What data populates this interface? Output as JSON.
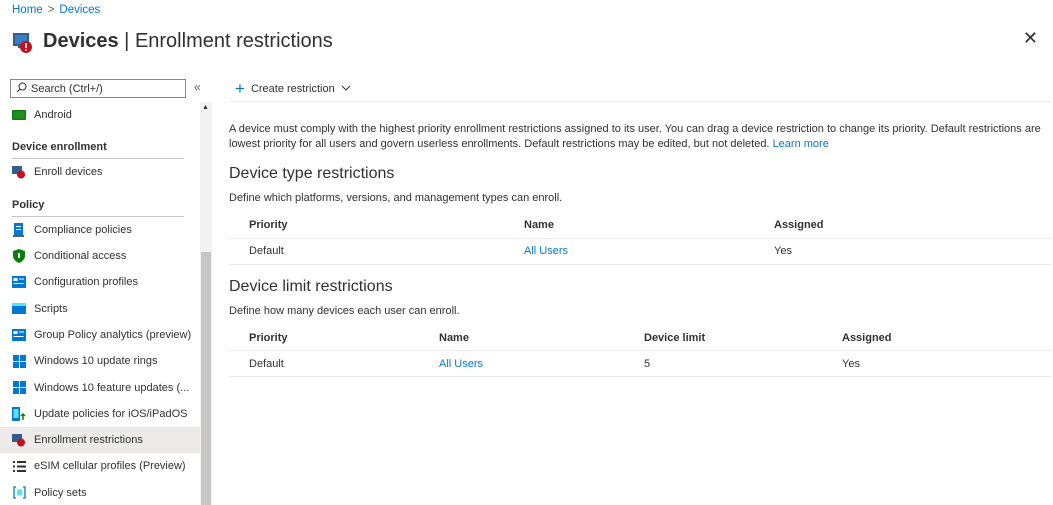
{
  "breadcrumb": {
    "home": "Home",
    "separator": ">",
    "current": "Devices"
  },
  "header": {
    "title_bold": "Devices",
    "title_sep": " | ",
    "title_rest": "Enrollment restrictions",
    "close": "✕"
  },
  "sidebar": {
    "search_placeholder": "Search (Ctrl+/)",
    "collapse": "«",
    "items": [
      {
        "label": "Android",
        "icon": "android-icon"
      },
      {
        "section": "Device enrollment"
      },
      {
        "label": "Enroll devices",
        "icon": "enroll-devices-icon"
      },
      {
        "section": "Policy"
      },
      {
        "label": "Compliance policies",
        "icon": "compliance-icon"
      },
      {
        "label": "Conditional access",
        "icon": "shield-icon"
      },
      {
        "label": "Configuration profiles",
        "icon": "config-profile-icon"
      },
      {
        "label": "Scripts",
        "icon": "scripts-icon"
      },
      {
        "label": "Group Policy analytics (preview)",
        "icon": "group-policy-icon"
      },
      {
        "label": "Windows 10 update rings",
        "icon": "windows-icon"
      },
      {
        "label": "Windows 10 feature updates (...",
        "icon": "windows-icon"
      },
      {
        "label": "Update policies for iOS/iPadOS",
        "icon": "ios-update-icon"
      },
      {
        "label": "Enrollment restrictions",
        "icon": "enrollment-restrictions-icon",
        "selected": true
      },
      {
        "label": "eSIM cellular profiles (Preview)",
        "icon": "esim-icon"
      },
      {
        "label": "Policy sets",
        "icon": "policy-sets-icon"
      }
    ]
  },
  "toolbar": {
    "create_label": "Create restriction"
  },
  "description": {
    "text": "A device must comply with the highest priority enrollment restrictions assigned to its user. You can drag a device restriction to change its priority. Default restrictions are lowest priority for all users and govern userless enrollments. Default restrictions may be edited, but not deleted.",
    "link": "Learn more"
  },
  "device_type": {
    "title": "Device type restrictions",
    "subtitle": "Define which platforms, versions, and management types can enroll.",
    "columns": [
      "Priority",
      "Name",
      "Assigned"
    ],
    "rows": [
      {
        "priority": "Default",
        "name": "All Users",
        "assigned": "Yes"
      }
    ]
  },
  "device_limit": {
    "title": "Device limit restrictions",
    "subtitle": "Define how many devices each user can enroll.",
    "columns": [
      "Priority",
      "Name",
      "Device limit",
      "Assigned"
    ],
    "rows": [
      {
        "priority": "Default",
        "name": "All Users",
        "limit": "5",
        "assigned": "Yes"
      }
    ]
  },
  "colors": {
    "accent": "#0078d4",
    "selected_bg": "#edebe9",
    "text": "#323130"
  }
}
